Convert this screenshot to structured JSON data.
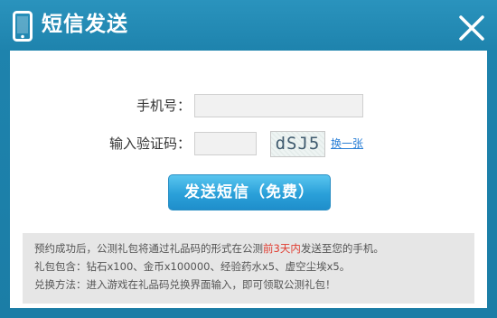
{
  "dialog": {
    "title": "短信发送",
    "close_label": "×"
  },
  "form": {
    "phone_label": "手机号：",
    "phone_value": "",
    "captcha_label": "输入验证码：",
    "captcha_value": "",
    "captcha_text": "dSJ5",
    "refresh_label": "换一张",
    "send_label": "发送短信（免费）"
  },
  "notice": {
    "line1_prefix": "预约成功后，公测礼包将通过礼品码的形式在公测",
    "line1_highlight": "前3天内",
    "line1_suffix": "发送至您的手机。",
    "line2": "礼包包含：钻石x100、金币x100000、经验药水x5、虚空尘埃x5。",
    "line3": "兑换方法：进入游戏在礼品码兑换界面输入，即可领取公测礼包！"
  },
  "colors": {
    "frame": "#1e83ad",
    "button": "#2aa0d9",
    "highlight": "#e03b2f",
    "link": "#2a7fd6"
  }
}
